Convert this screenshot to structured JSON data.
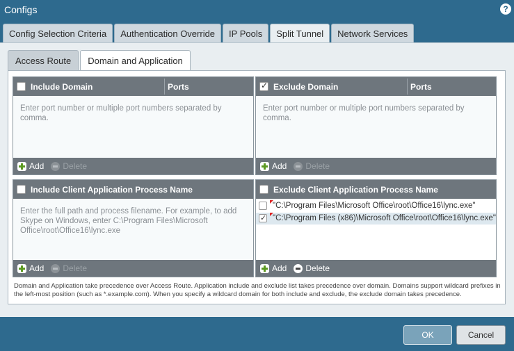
{
  "window": {
    "title": "Configs"
  },
  "outer_tabs": [
    {
      "label": "Config Selection Criteria"
    },
    {
      "label": "Authentication Override"
    },
    {
      "label": "IP Pools"
    },
    {
      "label": "Split Tunnel",
      "active": true
    },
    {
      "label": "Network Services"
    }
  ],
  "inner_tabs": [
    {
      "label": "Access Route"
    },
    {
      "label": "Domain and Application",
      "active": true
    }
  ],
  "include_domain": {
    "col1": "Include Domain",
    "col2": "Ports",
    "placeholder": "Enter port number or multiple port numbers separated by comma.",
    "add": "Add",
    "delete": "Delete"
  },
  "exclude_domain": {
    "col1": "Exclude Domain",
    "col2": "Ports",
    "header_checked": true,
    "placeholder": "Enter port number or multiple port numbers separated by comma.",
    "add": "Add",
    "delete": "Delete"
  },
  "include_app": {
    "col1": "Include Client Application Process Name",
    "placeholder": "Enter the full path and process filename. For example, to add Skype on Windows, enter C:\\Program Files\\Microsoft Office\\root\\Office16\\lync.exe",
    "add": "Add",
    "delete": "Delete"
  },
  "exclude_app": {
    "col1": "Exclude Client Application Process Name",
    "rows": [
      {
        "text": "\"C:\\Program Files\\Microsoft Office\\root\\Office16\\lync.exe\"",
        "checked": false
      },
      {
        "text": "\"C:\\Program Files (x86)\\Microsoft Office\\root\\Office16\\lync.exe\"",
        "checked": true
      }
    ],
    "add": "Add",
    "delete": "Delete"
  },
  "note": "Domain and Application take precedence over Access Route. Application include and exclude list takes precedence over domain. Domains support wildcard prefixes in the left-most position (such as *.example.com). When you specify a wildcard domain for both include and exclude, the exclude domain takes precedence.",
  "buttons": {
    "ok": "OK",
    "cancel": "Cancel"
  }
}
